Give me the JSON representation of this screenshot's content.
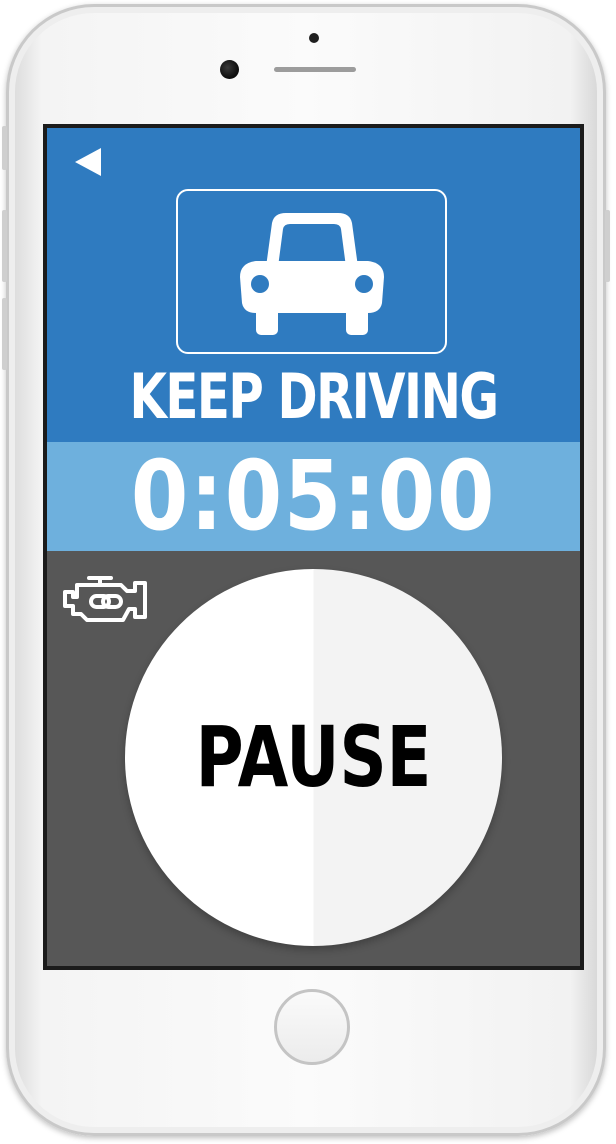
{
  "header": {
    "back_icon": "back-arrow-icon",
    "car_icon": "car-front-icon",
    "status_text": "KEEP DRIVING"
  },
  "timer": {
    "value": "0:05:00"
  },
  "engine": {
    "icon": "check-engine-icon"
  },
  "controls": {
    "pause_label": "PAUSE"
  },
  "colors": {
    "header_blue": "#2f7bc0",
    "timer_blue": "#6eb0dd",
    "panel_gray": "#575757",
    "button_white": "#ffffff",
    "text_black": "#000000"
  }
}
